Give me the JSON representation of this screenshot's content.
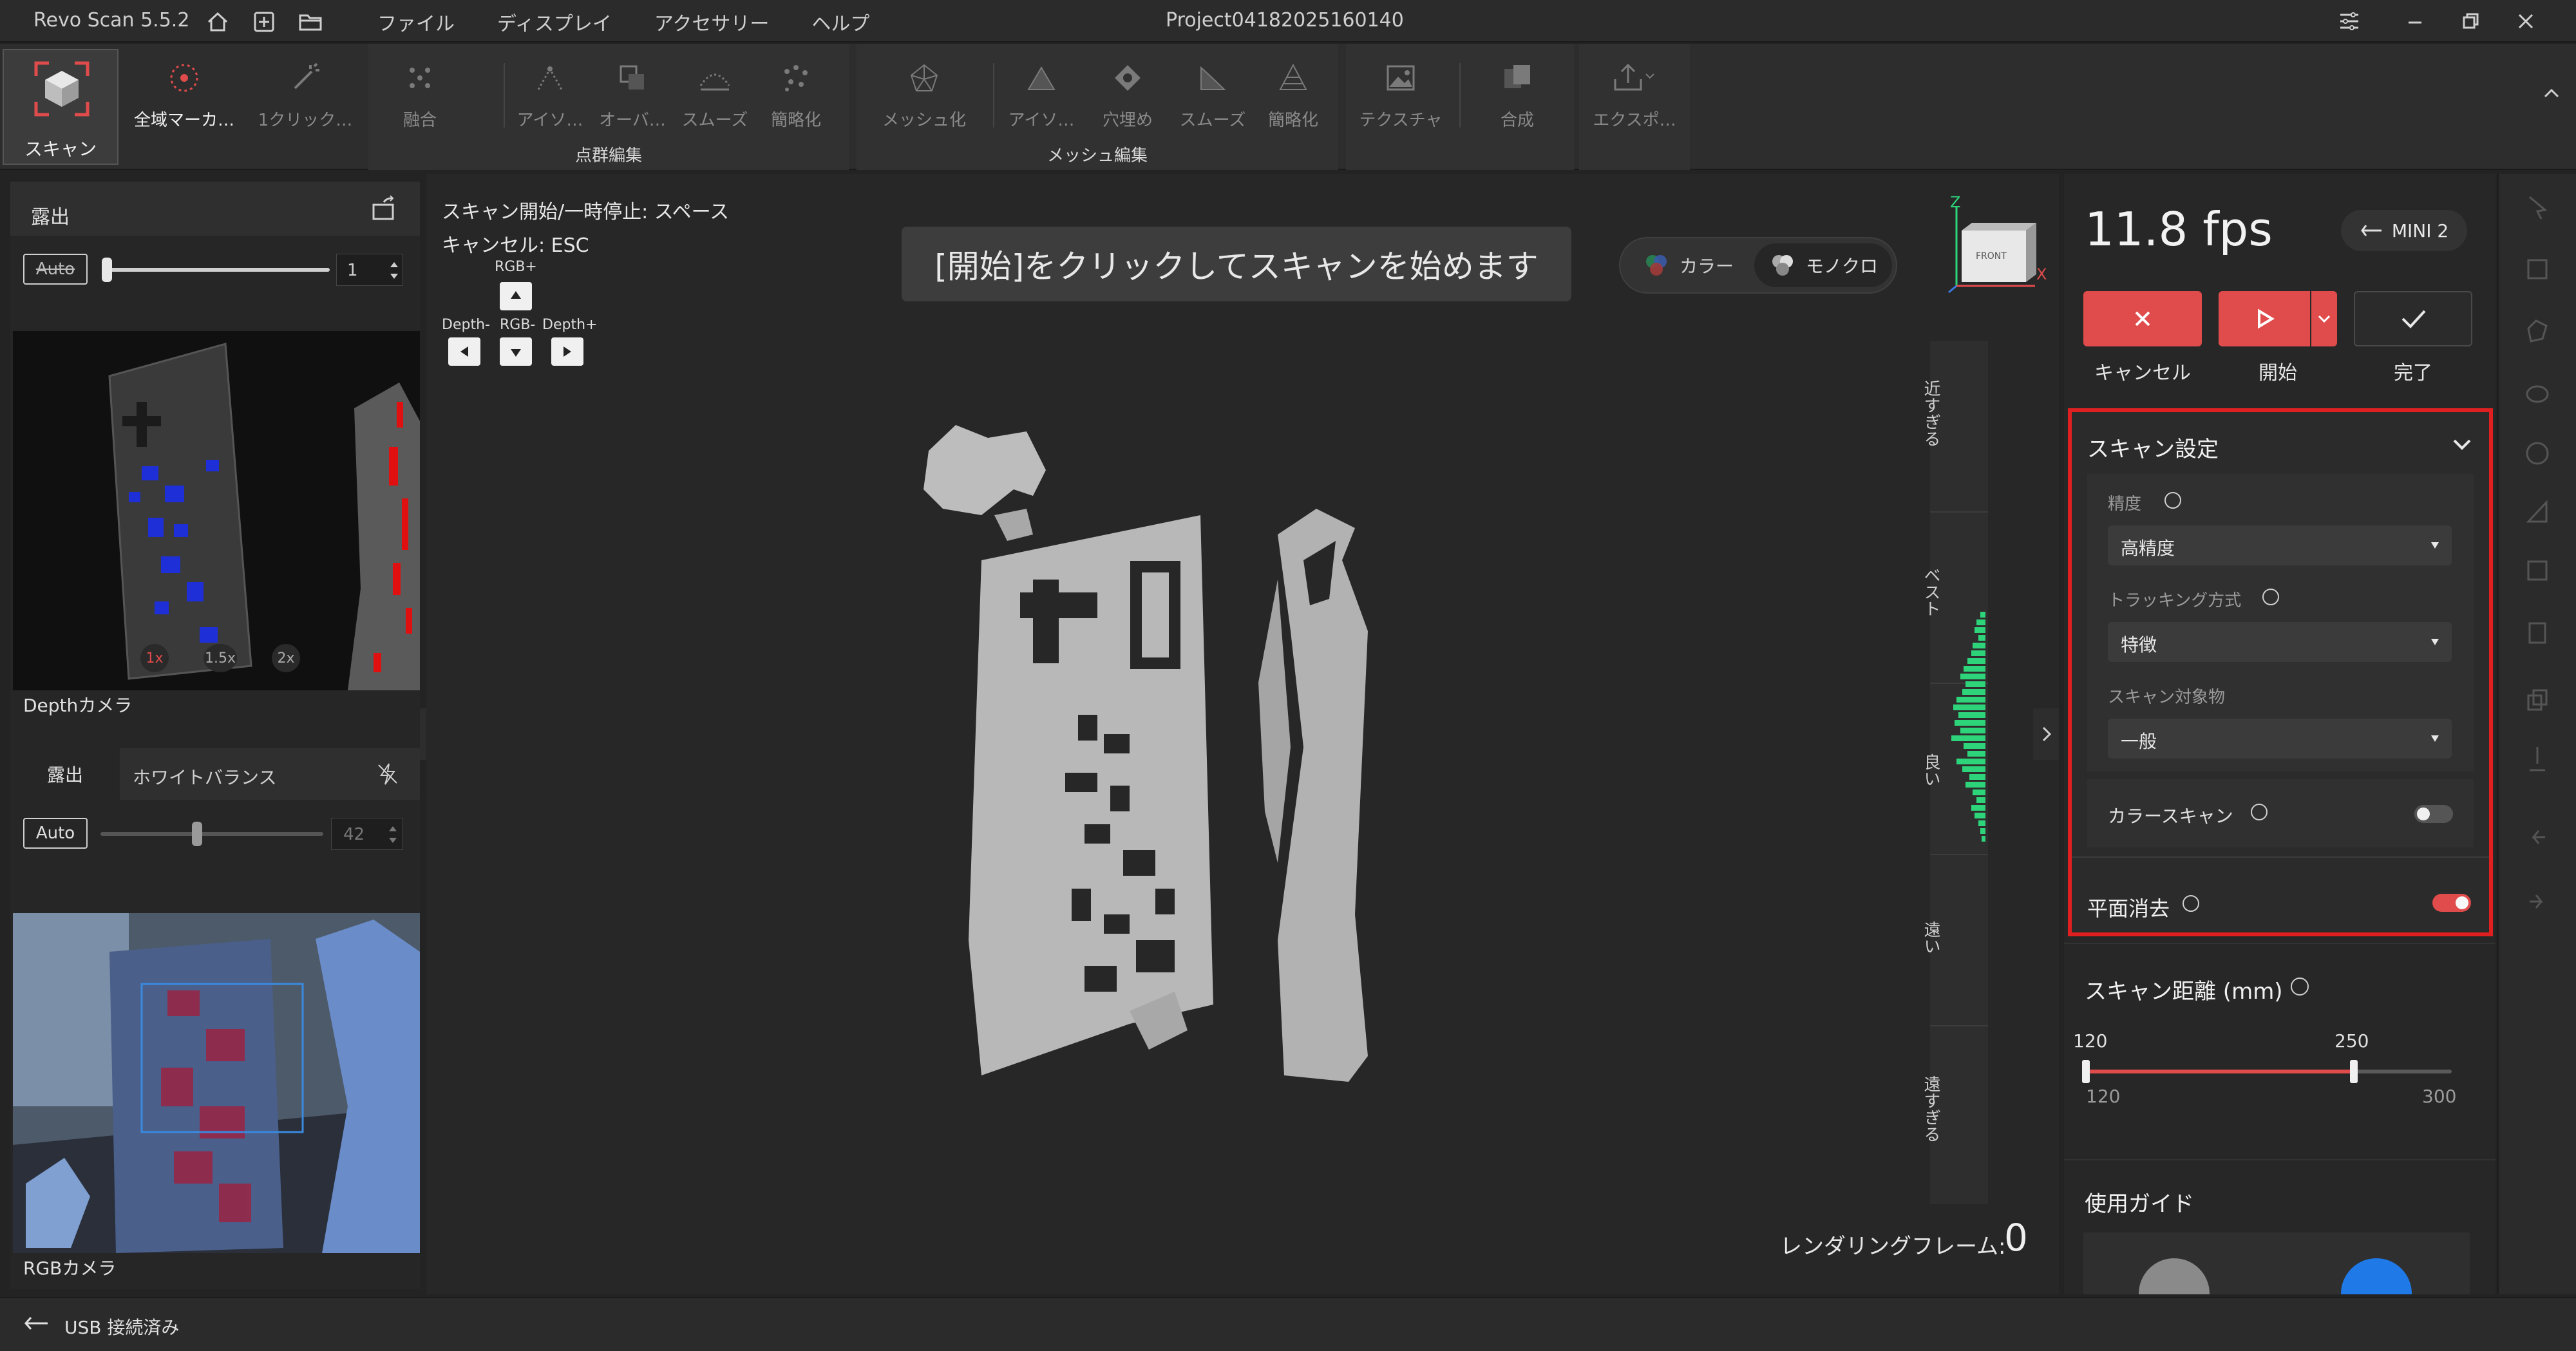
{
  "app": {
    "name": "Revo Scan 5.5.2",
    "project": "Project04182025160140"
  },
  "menu": [
    "ファイル",
    "ディスプレイ",
    "アクセサリー",
    "ヘルプ"
  ],
  "toolbar": {
    "scan": "スキャン",
    "global_marker": "全域マーカ…",
    "one_click": "1クリック…",
    "point_cloud_group": "点群編集",
    "mesh_group": "メッシュ編集",
    "pc_tools": [
      "融合",
      "アイソ…",
      "オーバ…",
      "スムーズ",
      "簡略化"
    ],
    "mesh_tools": [
      "メッシュ化",
      "アイソ…",
      "穴埋め",
      "スムーズ",
      "簡略化"
    ],
    "texture": "テクスチャ",
    "merge": "合成",
    "export": "エクスポ…"
  },
  "left": {
    "exposure_title": "露出",
    "auto": "Auto",
    "exposure_value": "1",
    "zoom": [
      "1x",
      "1.5x",
      "2x"
    ],
    "depth_label": "Depthカメラ",
    "tabs": [
      "露出",
      "ホワイトバランス"
    ],
    "rgb_value": "42",
    "rgb_label": "RGBカメラ"
  },
  "viewport": {
    "hint1": "スキャン開始/一時停止: スペース",
    "hint2": "キャンセル: ESC",
    "rgb_plus": "RGB+",
    "depth_minus": "Depth-",
    "rgb_minus": "RGB-",
    "depth_plus": "Depth+",
    "banner": "[開始]をクリックしてスキャンを始めます",
    "color": "カラー",
    "mono": "モノクロ",
    "gizmo_front": "FRONT",
    "axis_z": "Z",
    "axis_x": "X",
    "distance_labels": [
      "近すぎる",
      "ベスト",
      "良い",
      "遠い",
      "遠すぎる"
    ],
    "render_label": "レンダリングフレーム:",
    "render_value": "0"
  },
  "right": {
    "fps": "11.8 fps",
    "device": "MINI 2",
    "cancel": "キャンセル",
    "start": "開始",
    "done": "完了",
    "scan_settings": "スキャン設定",
    "accuracy_label": "精度",
    "accuracy_value": "高精度",
    "tracking_label": "トラッキング方式",
    "tracking_value": "特徴",
    "object_label": "スキャン対象物",
    "object_value": "一般",
    "color_scan": "カラースキャン",
    "plane_removal": "平面消去",
    "scan_distance": "スキャン距離 (mm)",
    "dist_low": "120",
    "dist_high": "250",
    "dist_min": "120",
    "dist_max": "300",
    "guide": "使用ガイド"
  },
  "distance_bars": [
    0.15,
    0.25,
    0.3,
    0.2,
    0.35,
    0.4,
    0.5,
    0.6,
    0.7,
    0.55,
    0.65,
    0.8,
    0.9,
    0.75,
    0.85,
    0.7,
    0.95,
    0.6,
    0.5,
    0.8,
    0.65,
    0.45,
    0.55,
    0.35,
    0.25,
    0.4,
    0.3,
    0.2,
    0.15,
    0.1
  ],
  "status": {
    "usb": "USB 接続済み"
  },
  "colors": {
    "accent": "#e04b4b",
    "highlight": "#e02020",
    "bars": "#2ed47a"
  },
  "icons": [
    "home-icon",
    "new-project-icon",
    "folder-icon",
    "settings-icon",
    "minimize-icon",
    "restore-icon",
    "close-icon",
    "scan-icon",
    "collapse-icon"
  ]
}
